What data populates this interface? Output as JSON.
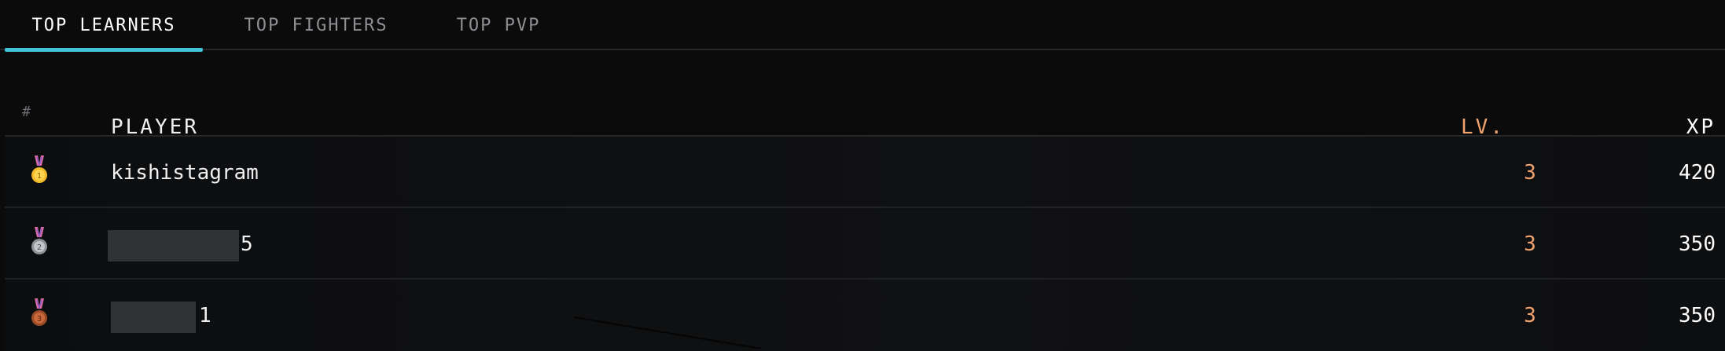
{
  "tabs": [
    {
      "label": "TOP LEARNERS",
      "active": true
    },
    {
      "label": "TOP FIGHTERS",
      "active": false
    },
    {
      "label": "TOP PVP",
      "active": false
    }
  ],
  "table": {
    "headers": {
      "rank": "#",
      "player": "PLAYER",
      "level": "LV.",
      "xp": "XP"
    },
    "rows": [
      {
        "medal": "gold-medal-icon",
        "rank_label": "1",
        "player": "kishistagram",
        "level": "3",
        "xp": "420"
      },
      {
        "medal": "silver-medal-icon",
        "rank_label": "2",
        "player": "5",
        "level": "3",
        "xp": "350"
      },
      {
        "medal": "bronze-medal-icon",
        "rank_label": "3",
        "player": "1",
        "level": "3",
        "xp": "350"
      }
    ]
  },
  "colors": {
    "background": "#0b0b0c",
    "accent": "#42c2d6",
    "level": "#f0a36d",
    "muted": "#6c6e72"
  }
}
